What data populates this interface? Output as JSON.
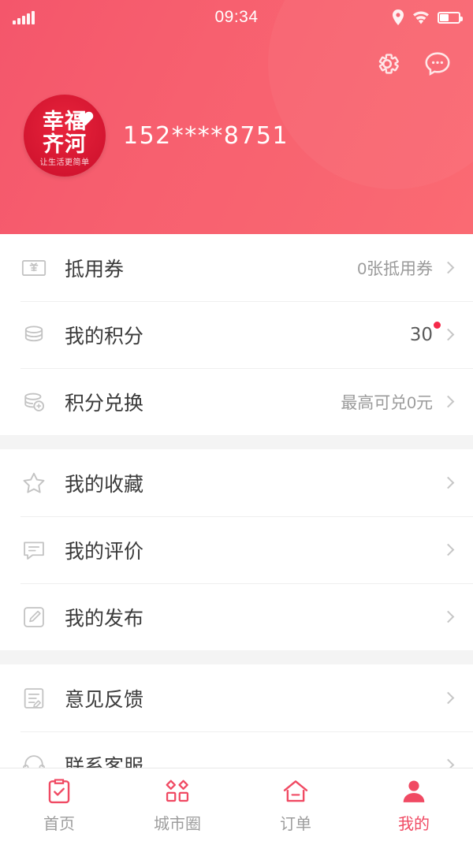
{
  "status_bar": {
    "signal_icon": "signal-bars-icon",
    "time": "09:34",
    "location_icon": "location-pin-icon",
    "wifi_icon": "wifi-icon",
    "battery_icon": "battery-icon"
  },
  "header": {
    "settings_icon": "gear-icon",
    "message_icon": "chat-bubble-icon",
    "avatar": {
      "logo_line1": "幸福",
      "logo_line2": "齐河",
      "logo_sub": "让生活更简单"
    },
    "phone_number": "152****8751",
    "background_color": "#f7606f"
  },
  "menu": {
    "groups": [
      {
        "items": [
          {
            "icon": "coupon-icon",
            "label": "抵用券",
            "value": "0张抵用券",
            "badge": false
          },
          {
            "icon": "coins-icon",
            "label": "我的积分",
            "value": "30",
            "badge": true
          },
          {
            "icon": "points-exchange-icon",
            "label": "积分兑换",
            "value": "最高可兑0元",
            "badge": false
          }
        ]
      },
      {
        "items": [
          {
            "icon": "star-icon",
            "label": "我的收藏",
            "value": "",
            "badge": false
          },
          {
            "icon": "comment-icon",
            "label": "我的评价",
            "value": "",
            "badge": false
          },
          {
            "icon": "edit-note-icon",
            "label": "我的发布",
            "value": "",
            "badge": false
          }
        ]
      },
      {
        "items": [
          {
            "icon": "feedback-icon",
            "label": "意见反馈",
            "value": "",
            "badge": false
          },
          {
            "icon": "headset-icon",
            "label": "联系客服",
            "value": "",
            "badge": false
          }
        ]
      }
    ]
  },
  "tabbar": {
    "active_color": "#f04a63",
    "inactive_color": "#9d9d9d",
    "tabs": [
      {
        "icon": "home-clipboard-icon",
        "label": "首页",
        "active": false
      },
      {
        "icon": "city-circle-icon",
        "label": "城市圈",
        "active": false
      },
      {
        "icon": "order-house-icon",
        "label": "订单",
        "active": false
      },
      {
        "icon": "profile-person-icon",
        "label": "我的",
        "active": true
      }
    ]
  }
}
